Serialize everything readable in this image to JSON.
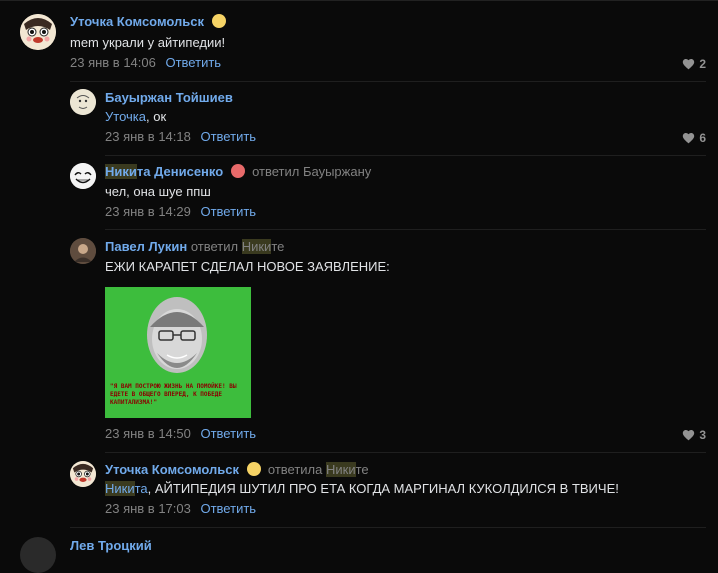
{
  "comments": [
    {
      "author": "Уточка Комсомольск",
      "text": "mem украли у айтипедии!",
      "date": "23 янв в 14:06",
      "reply_label": "Ответить",
      "likes": "2",
      "badge_icon": "chick-emoji-icon"
    },
    {
      "author": "Бауыржан Тойшиев",
      "text_mention": "Уточка",
      "text_rest": ", ок",
      "date": "23 янв в 14:18",
      "reply_label": "Ответить",
      "likes": "6"
    },
    {
      "author_hl": "Ники",
      "author_rest": "та Денисенко",
      "replied_prefix": "ответил",
      "replied_to": "Бауыржану",
      "text": "чел, она шуе ппш",
      "date": "23 янв в 14:29",
      "reply_label": "Ответить",
      "badge_icon": "clown-emoji-icon"
    },
    {
      "author": "Павел Лукин",
      "replied_prefix": "ответил",
      "replied_to_hl": "Ники",
      "replied_to_rest": "те",
      "text": "ЕЖИ КАРАПЕТ СДЕЛАЛ НОВОЕ ЗАЯВЛЕНИЕ:",
      "meme_caption": "\"Я ВАМ ПОСТРОЮ ЖИЗНЬ НА ПОМОЙКЕ! ВЫ ЕДЕТЕ В ОБЩЕГО ВПЕРЕД, К ПОБЕДЕ КАПИТАЛИЗМА!\"",
      "date": "23 янв в 14:50",
      "reply_label": "Ответить",
      "likes": "3"
    },
    {
      "author": "Уточка Комсомольск",
      "replied_prefix": "ответила",
      "replied_to_hl": "Ники",
      "replied_to_rest": "те",
      "text_mention_hl": "Ники",
      "text_mention_rest": "та",
      "text_rest": ", АЙТИПЕДИЯ ШУТИЛ ПРО ЕТА КОГДА МАРГИНАЛ КУКОЛДИЛСЯ В ТВИЧЕ!",
      "date": "23 янв в 17:03",
      "reply_label": "Ответить",
      "badge_icon": "chick-emoji-icon"
    },
    {
      "author": "Лев Троцкий"
    }
  ],
  "colors": {
    "background": "#0a0a0a",
    "link": "#71aaeb",
    "muted": "#828282",
    "text": "#e1e3e6",
    "highlight": "#3a3a1f"
  }
}
